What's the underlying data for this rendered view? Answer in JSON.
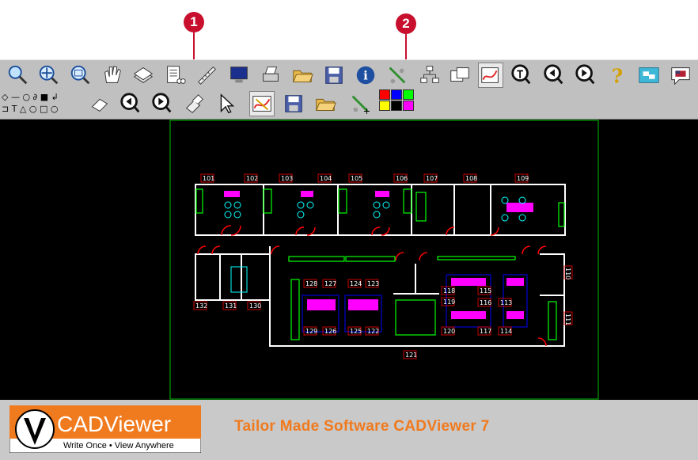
{
  "callouts": {
    "first": "1",
    "second": "2"
  },
  "toolbar_row1": [
    {
      "name": "zoom-in-icon"
    },
    {
      "name": "zoom-extents-icon"
    },
    {
      "name": "zoom-window-icon"
    },
    {
      "name": "pan-icon"
    },
    {
      "name": "layers-icon"
    },
    {
      "name": "print-list-icon"
    },
    {
      "name": "measure-icon"
    },
    {
      "name": "screen-icon"
    },
    {
      "name": "printer-icon"
    },
    {
      "name": "open-folder-icon"
    },
    {
      "name": "save-icon"
    },
    {
      "name": "info-icon"
    },
    {
      "name": "network-icon"
    },
    {
      "name": "hierarchy-icon"
    },
    {
      "name": "compare-icon"
    },
    {
      "name": "redline-icon"
    },
    {
      "name": "magnify-icon"
    },
    {
      "name": "previous-view-icon"
    },
    {
      "name": "next-view-icon"
    },
    {
      "name": "help-icon"
    },
    {
      "name": "toggle-icon"
    },
    {
      "name": "language-icon"
    }
  ],
  "toolbar_row2": [
    {
      "name": "eraser-icon"
    },
    {
      "name": "previous-redline-icon"
    },
    {
      "name": "next-redline-icon"
    },
    {
      "name": "clear-icon"
    },
    {
      "name": "select-arrow-icon"
    },
    {
      "name": "redline-edit-icon"
    },
    {
      "name": "save-redline-icon"
    },
    {
      "name": "open-redline-icon"
    },
    {
      "name": "network-add-icon"
    }
  ],
  "shape_tools": {
    "row1": "◇ — ○ ∂ ■ ↲",
    "row2": "⊐ T △ ○ □ ○"
  },
  "palette": [
    "#ff0000",
    "#0000ff",
    "#00ff00",
    "#ffff00",
    "#000000",
    "#ff00ff"
  ],
  "rooms_top": [
    "101",
    "102",
    "103",
    "104",
    "105",
    "106",
    "107",
    "108",
    "109"
  ],
  "rooms_bottom_left": [
    "132",
    "131",
    "130"
  ],
  "rooms_center_left": [
    "128",
    "127",
    "129",
    "126"
  ],
  "rooms_center_mid": [
    "124",
    "123",
    "125",
    "122"
  ],
  "rooms_right": [
    "118",
    "115",
    "119",
    "116",
    "120",
    "117",
    "113",
    "114"
  ],
  "room_right_top": "110",
  "room_right_bottom": "111",
  "room_bottom_center": "121",
  "logo": {
    "brand": "CADViewer",
    "tagline": "Write Once • View Anywhere"
  },
  "footer_title": "Tailor Made Software CADViewer 7",
  "colors": {
    "callout": "#c8102e",
    "footer_text": "#f07a1e",
    "cad_lines": "#ffffff",
    "cad_furniture": "#00ff00"
  }
}
